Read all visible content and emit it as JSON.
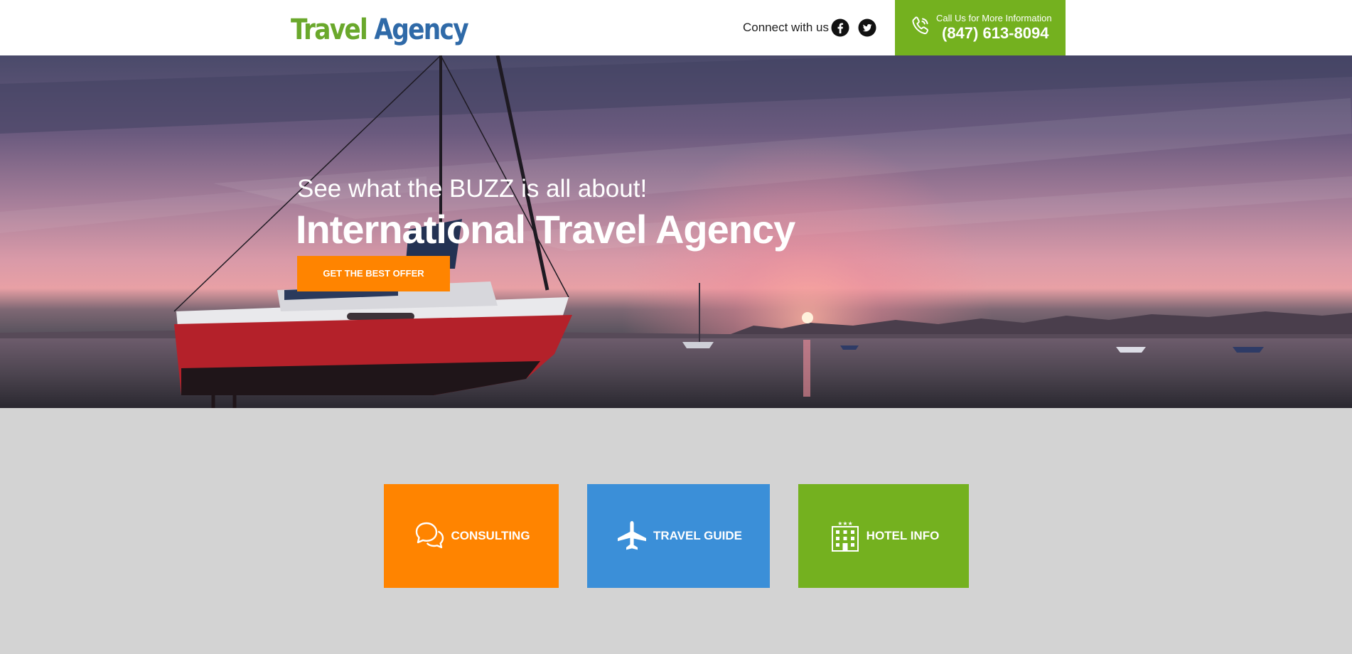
{
  "header": {
    "logo": {
      "word1": "Travel",
      "word2": "Agency"
    },
    "connect_text": "Connect with us",
    "social": [
      {
        "icon": "facebook-icon"
      },
      {
        "icon": "twitter-icon"
      }
    ],
    "call": {
      "label": "Call Us for More Information",
      "number": "(847) 613-8094",
      "icon": "phone-icon"
    }
  },
  "hero": {
    "subtitle": "See what the BUZZ is all about!",
    "title": "International Travel Agency",
    "cta_label": "GET THE BEST OFFER"
  },
  "features": [
    {
      "label": "CONSULTING",
      "icon": "chat-bubbles-icon",
      "color": "#ff8400"
    },
    {
      "label": "TRAVEL GUIDE",
      "icon": "airplane-icon",
      "color": "#3b8fd8"
    },
    {
      "label": "HOTEL INFO",
      "icon": "hotel-building-icon",
      "color": "#74b11f"
    }
  ],
  "colors": {
    "orange": "#ff8400",
    "green": "#74b11f",
    "blue": "#3b8fd8",
    "logo_green": "#6aa82c",
    "logo_blue": "#2f6aa8"
  }
}
